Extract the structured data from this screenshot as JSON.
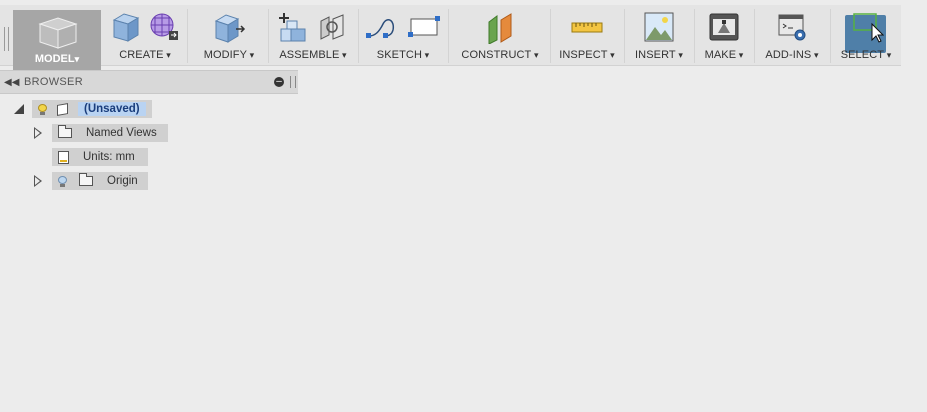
{
  "toolbar": {
    "workspace": "MODEL",
    "groups": [
      {
        "label": "CREATE",
        "icons": [
          "box-icon",
          "form-grid-icon"
        ]
      },
      {
        "label": "MODIFY",
        "icons": [
          "push-pull-icon"
        ]
      },
      {
        "label": "ASSEMBLE",
        "icons": [
          "new-component-icon",
          "joint-icon"
        ]
      },
      {
        "label": "SKETCH",
        "icons": [
          "spline-icon",
          "rectangle-icon"
        ]
      },
      {
        "label": "CONSTRUCT",
        "icons": [
          "offset-plane-icon"
        ]
      },
      {
        "label": "INSPECT",
        "icons": [
          "measure-ruler-icon"
        ]
      },
      {
        "label": "INSERT",
        "icons": [
          "insert-image-icon"
        ]
      },
      {
        "label": "MAKE",
        "icons": [
          "3d-print-icon"
        ]
      },
      {
        "label": "ADD-INS",
        "icons": [
          "scripts-addins-icon"
        ]
      },
      {
        "label": "SELECT",
        "icons": [
          "select-cursor-icon"
        ]
      }
    ]
  },
  "browser": {
    "title": "BROWSER",
    "root": {
      "label": "(Unsaved)"
    },
    "items": [
      {
        "label": "Named Views"
      },
      {
        "label": "Units: mm"
      },
      {
        "label": "Origin"
      }
    ]
  },
  "colors": {
    "select_highlight": "#4f7fa8",
    "root_highlight": "#b9d3f2",
    "root_text": "#1a3d7c"
  }
}
